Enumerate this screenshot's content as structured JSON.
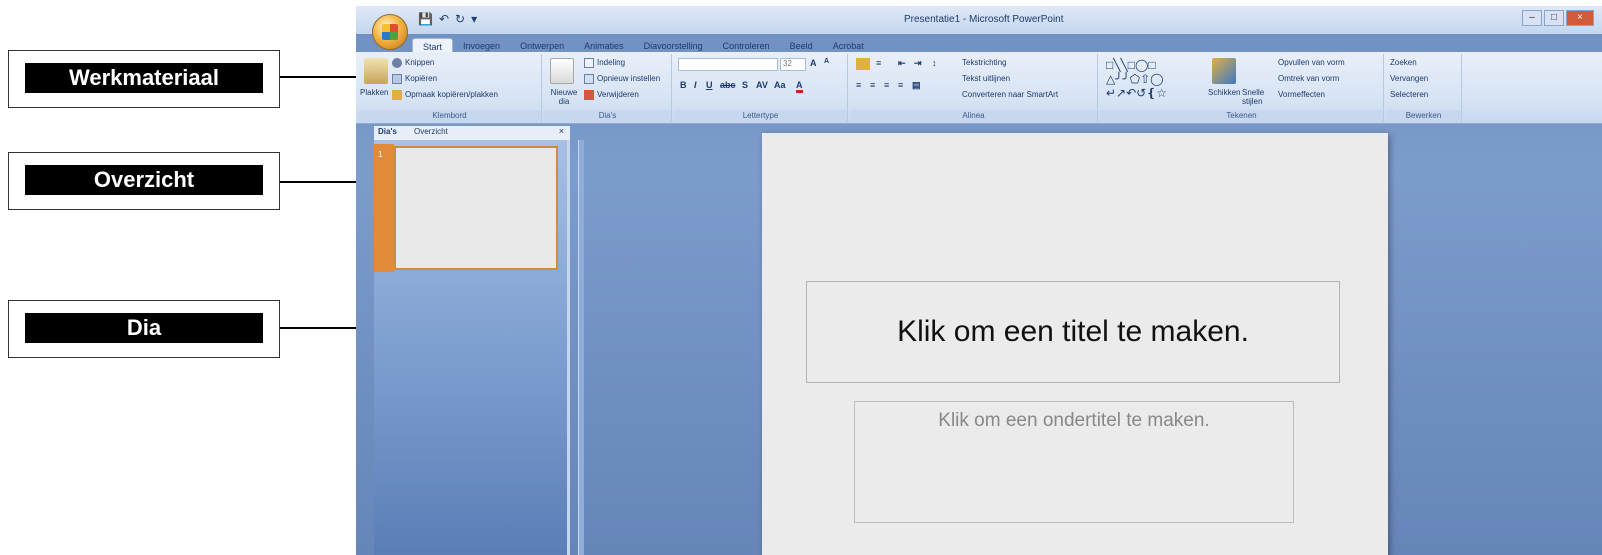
{
  "callouts": {
    "werkmateriaal": "Werkmateriaal",
    "overzicht": "Overzicht",
    "dia": "Dia"
  },
  "window": {
    "title": "Presentatie1 - Microsoft PowerPoint"
  },
  "tabs": [
    "Start",
    "Invoegen",
    "Ontwerpen",
    "Animaties",
    "Diavoorstelling",
    "Controleren",
    "Beeld",
    "Acrobat"
  ],
  "ribbon": {
    "clipboard": {
      "paste": "Plakken",
      "cut": "Knippen",
      "copy": "Kopiëren",
      "format_painter": "Opmaak kopiëren/plakken",
      "label": "Klembord"
    },
    "slides": {
      "new_slide": "Nieuwe dia",
      "layout": "Indeling",
      "reset": "Opnieuw instellen",
      "delete": "Verwijderen",
      "label": "Dia's"
    },
    "font": {
      "label": "Lettertype",
      "size": "32"
    },
    "paragraph": {
      "text_direction": "Tekstrichting",
      "align_text": "Tekst uitlijnen",
      "convert_smartart": "Converteren naar SmartArt",
      "label": "Alinea"
    },
    "drawing": {
      "arrange": "Schikken",
      "quick_styles": "Snelle stijlen",
      "shape_fill": "Opvullen van vorm",
      "shape_outline": "Omtrek van vorm",
      "shape_effects": "Vormeffecten",
      "label": "Tekenen"
    },
    "editing": {
      "find": "Zoeken",
      "replace": "Vervangen",
      "select": "Selecteren",
      "label": "Bewerken"
    }
  },
  "slides_pane": {
    "tab_slides": "Dia's",
    "tab_outline": "Overzicht",
    "close": "×",
    "thumb_number": "1"
  },
  "slide": {
    "title_placeholder": "Klik om een titel te maken.",
    "subtitle_placeholder": "Klik om een ondertitel te maken."
  }
}
